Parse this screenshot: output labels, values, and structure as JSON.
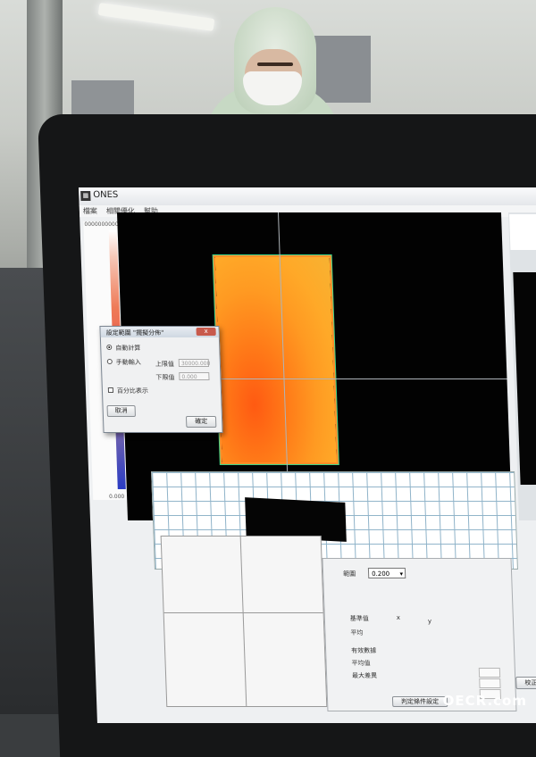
{
  "app": {
    "title": "ONES",
    "icon": "app-icon"
  },
  "menu": [
    {
      "label": "檔案"
    },
    {
      "label": "相關優化"
    },
    {
      "label": "幫助"
    }
  ],
  "scale": {
    "max": "0000000000",
    "min": "0.000"
  },
  "dialog": {
    "title": "設定範圍 \"擺擬分佈\"",
    "close_label": "x",
    "auto_label": "自動計算",
    "manual_label": "手動輸入",
    "upper_label": "上限值",
    "upper_value": "30000.000",
    "lower_label": "下限值",
    "lower_value": "0.000",
    "percent_label": "百分比表示",
    "cancel_label": "取消",
    "ok_label": "確定"
  },
  "stats": {
    "range_label": "範圍",
    "range_value": "0.200",
    "baseline_label": "基準值",
    "x_label": "x",
    "y_label": "y",
    "mean_label": "平均",
    "count_label": "有效數據",
    "average_label": "平均值",
    "max_diff_label": "最大差異",
    "settings_button": "判定條件設定",
    "calibrate_button": "校正數據"
  },
  "watermark": "OECR.com",
  "colors": {
    "heat_core": "#ff5a12",
    "heat_edge": "#f7b232",
    "view_bg": "#020202"
  }
}
